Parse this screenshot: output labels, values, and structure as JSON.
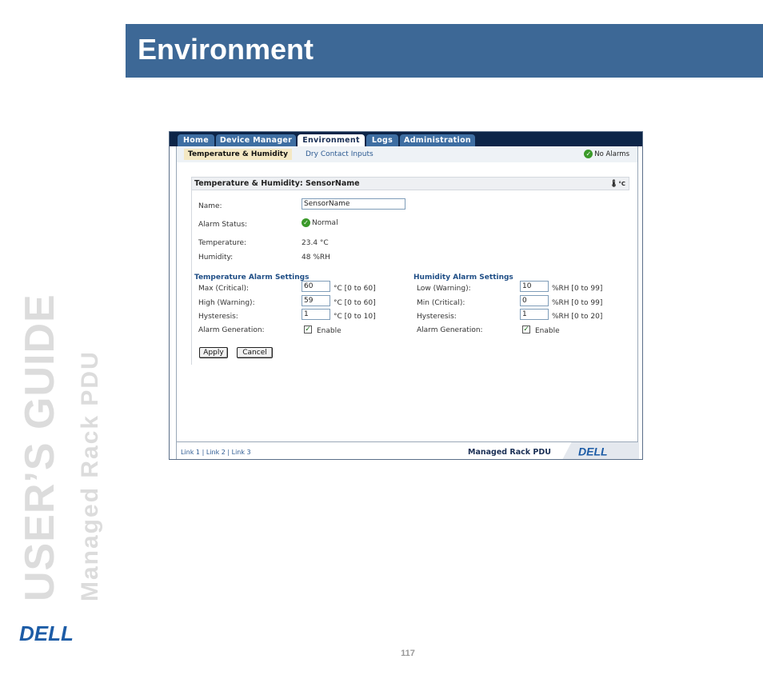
{
  "document": {
    "section_title": "Environment",
    "side_title": "USER’S GUIDE",
    "side_subtitle": "Managed Rack PDU",
    "page_number": "117",
    "logo_text": "DELL"
  },
  "app": {
    "tabs": [
      {
        "label": "Home",
        "active": false
      },
      {
        "label": "Device Manager",
        "active": false
      },
      {
        "label": "Environment",
        "active": true
      },
      {
        "label": "Logs",
        "active": false
      },
      {
        "label": "Administration",
        "active": false
      }
    ],
    "subtabs": [
      {
        "label": "Temperature & Humidity",
        "active": true
      },
      {
        "label": "Dry Contact Inputs",
        "active": false
      }
    ],
    "alarm_status_indicator": "No Alarms",
    "panel_title": "Temperature & Humidity: SensorName",
    "temp_unit_icon_text": "°C",
    "fields": {
      "name_label": "Name:",
      "name_value": "SensorName",
      "alarm_status_label": "Alarm Status:",
      "alarm_status_value": "Normal",
      "temperature_label": "Temperature:",
      "temperature_value": "23.4 °C",
      "humidity_label": "Humidity:",
      "humidity_value": "48 %RH"
    },
    "temp_alarm": {
      "title": "Temperature Alarm Settings",
      "max_label": "Max (Critical):",
      "max_value": "60",
      "max_range": "°C [0 to 60]",
      "high_label": "High (Warning):",
      "high_value": "59",
      "high_range": "°C [0 to 60]",
      "hyst_label": "Hysteresis:",
      "hyst_value": "1",
      "hyst_range": "°C [0 to 10]",
      "gen_label": "Alarm Generation:",
      "gen_checked": true,
      "gen_text": "Enable"
    },
    "hum_alarm": {
      "title": "Humidity Alarm Settings",
      "low_label": "Low (Warning):",
      "low_value": "10",
      "low_range": "%RH [0 to 99]",
      "min_label": "Min (Critical):",
      "min_value": "0",
      "min_range": "%RH [0 to 99]",
      "hyst_label": "Hysteresis:",
      "hyst_value": "1",
      "hyst_range": "%RH [0 to 20]",
      "gen_label": "Alarm Generation:",
      "gen_checked": true,
      "gen_text": "Enable"
    },
    "buttons": {
      "apply": "Apply",
      "cancel": "Cancel"
    },
    "footer": {
      "link1": "Link 1",
      "sep": "|",
      "link2": "Link 2",
      "link3": "Link 3",
      "product": "Managed Rack PDU",
      "logo_text": "DELL"
    }
  },
  "colors": {
    "header_blue": "#3d6896",
    "tabbar_navy": "#0d2548",
    "tab_blue": "#3e6ea2",
    "section_title_blue": "#1f4e86",
    "ok_green": "#3b9a2a",
    "side_text_gray": "#dcdcdc"
  },
  "icons": [
    "checkmark-circle-icon",
    "thermometer-icon",
    "dell-logo"
  ]
}
